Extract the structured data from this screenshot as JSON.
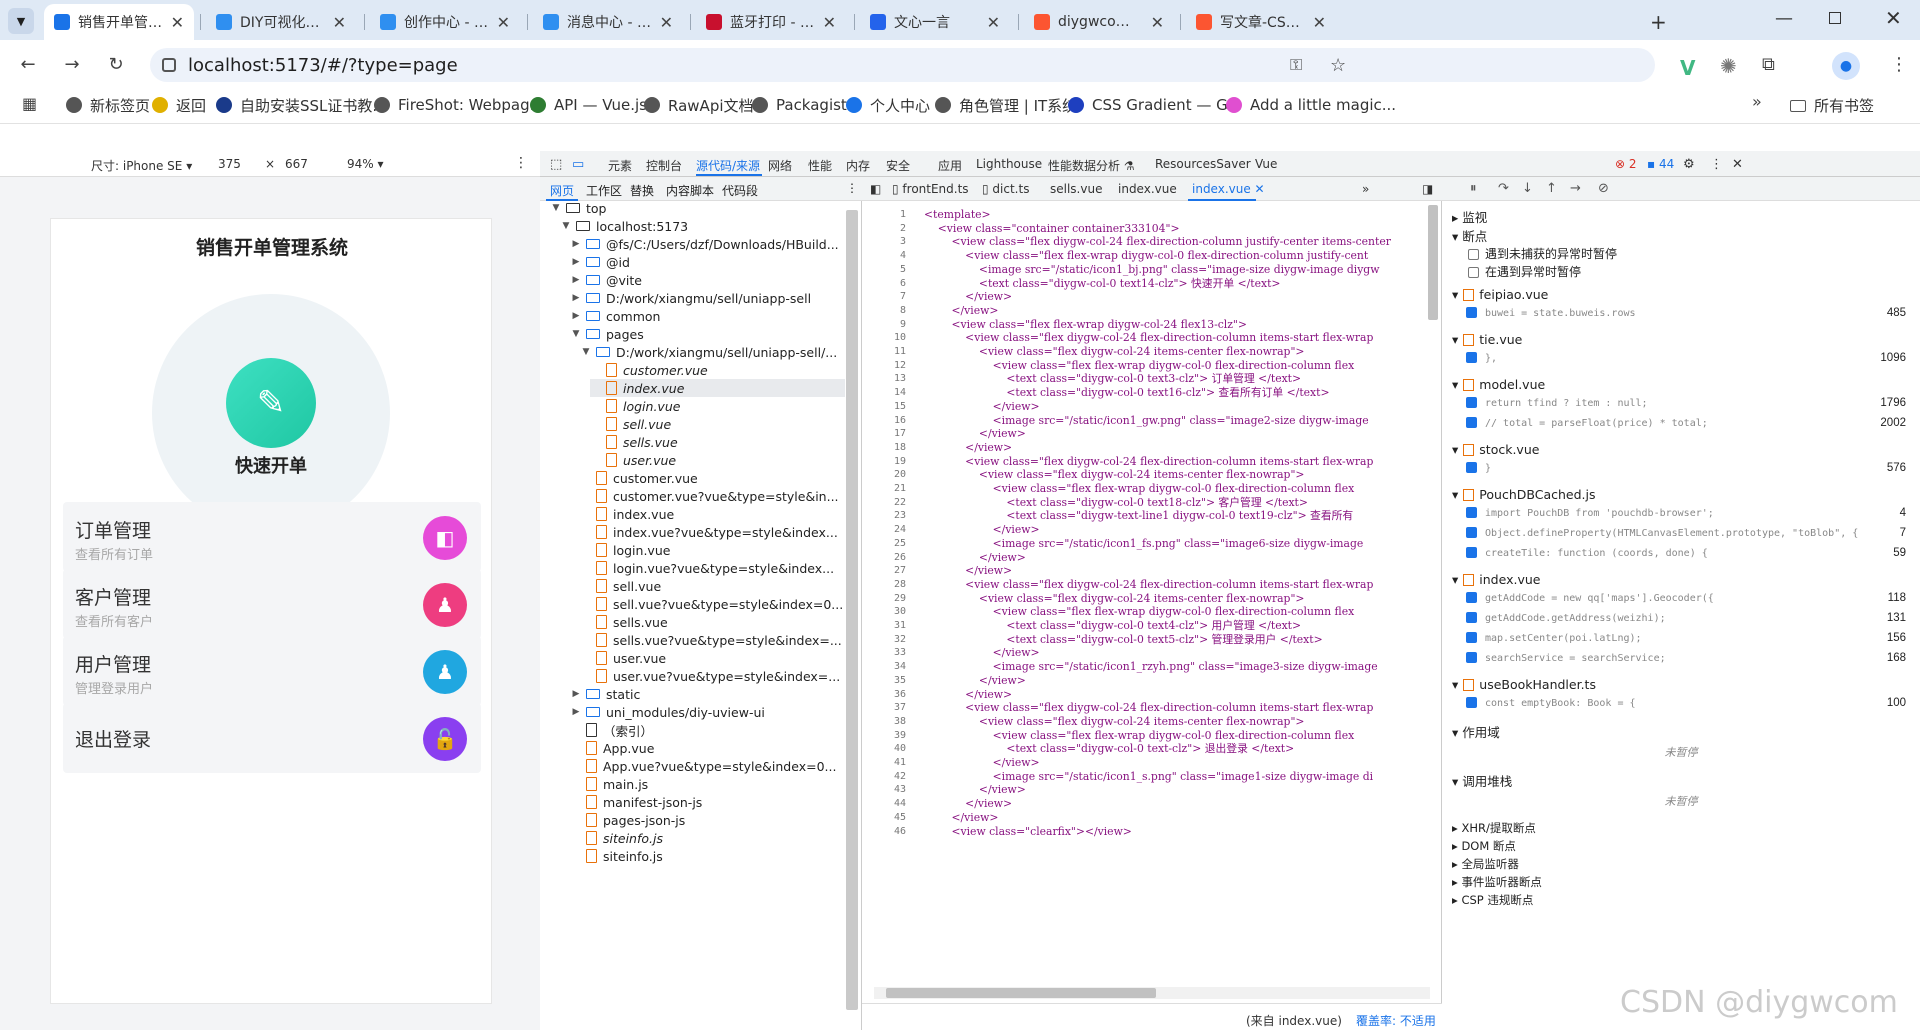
{
  "browser": {
    "tabs": [
      {
        "label": "销售开单管理系统",
        "color": "#1a73e8"
      },
      {
        "label": "DIY可视化的个人",
        "color": "#2f8ff0"
      },
      {
        "label": "创作中心 - 哔哩",
        "color": "#2f8ff0"
      },
      {
        "label": "消息中心 - 哔哩",
        "color": "#2f8ff0"
      },
      {
        "label": "蓝牙打印 - 商品",
        "color": "#c8102e"
      },
      {
        "label": "文心一言",
        "color": "#2463eb"
      },
      {
        "label": "diygwcom-CSD",
        "color": "#fc5531"
      },
      {
        "label": "写文章-CSDN创",
        "color": "#fc5531"
      }
    ],
    "url": "localhost:5173/#/?type=page",
    "bookmarks": [
      "新标签页",
      "返回",
      "自助安装SSL证书教...",
      "FireShot: Webpag...",
      "API — Vue.js",
      "RawApi文档",
      "Packagist",
      "个人中心",
      "角色管理 | IT系统",
      "CSS Gradient — G...",
      "Add a little magic..."
    ],
    "all_bookmarks": "所有书签"
  },
  "device_bar": {
    "size_label": "尺寸: iPhone SE",
    "width": "375",
    "times": "×",
    "height": "667",
    "zoom": "94%"
  },
  "app": {
    "title": "销售开单管理系统",
    "quick_label": "快速开单",
    "cards": [
      {
        "title": "订单管理",
        "subtitle": "查看所有订单",
        "color": "#e64bd8"
      },
      {
        "title": "客户管理",
        "subtitle": "查看所有客户",
        "color": "#ee3d80"
      },
      {
        "title": "用户管理",
        "subtitle": "管理登录用户",
        "color": "#20a7e0"
      },
      {
        "title": "退出登录",
        "subtitle": "",
        "color": "#8a3ff0"
      }
    ]
  },
  "devtools": {
    "top_tabs": [
      "元素",
      "控制台",
      "源代码/来源",
      "网络",
      "性能",
      "内存",
      "安全",
      "应用",
      "Lighthouse",
      "性能数据分析 ⚗",
      "ResourcesSaver",
      "Vue"
    ],
    "errors": "2",
    "messages": "44",
    "left_tabs": [
      "网页",
      "工作区",
      "替换",
      "内容脚本",
      "代码段"
    ],
    "editor_tabs": [
      "frontEnd.ts",
      "dict.ts",
      "sells.vue",
      "index.vue",
      "index.vue"
    ],
    "tree": [
      {
        "label": "top",
        "indent": 0,
        "kind": "frame",
        "arrow": "▼"
      },
      {
        "label": "localhost:5173",
        "indent": 1,
        "kind": "cloud",
        "arrow": "▼"
      },
      {
        "label": "@fs/C:/Users/dzf/Downloads/HBuild...",
        "indent": 2,
        "kind": "folder",
        "arrow": "▶"
      },
      {
        "label": "@id",
        "indent": 2,
        "kind": "folder",
        "arrow": "▶"
      },
      {
        "label": "@vite",
        "indent": 2,
        "kind": "folder",
        "arrow": "▶"
      },
      {
        "label": "D:/work/xiangmu/sell/uniapp-sell",
        "indent": 2,
        "kind": "folder",
        "arrow": "▶"
      },
      {
        "label": "common",
        "indent": 2,
        "kind": "folder",
        "arrow": "▶"
      },
      {
        "label": "pages",
        "indent": 2,
        "kind": "folder",
        "arrow": "▼"
      },
      {
        "label": "D:/work/xiangmu/sell/uniapp-sell/...",
        "indent": 3,
        "kind": "folder",
        "arrow": "▼"
      },
      {
        "label": "customer.vue",
        "indent": 4,
        "kind": "file",
        "arrow": "",
        "italic": true
      },
      {
        "label": "index.vue",
        "indent": 4,
        "kind": "file",
        "arrow": "",
        "italic": true,
        "selected": true
      },
      {
        "label": "login.vue",
        "indent": 4,
        "kind": "file",
        "arrow": "",
        "italic": true
      },
      {
        "label": "sell.vue",
        "indent": 4,
        "kind": "file",
        "arrow": "",
        "italic": true
      },
      {
        "label": "sells.vue",
        "indent": 4,
        "kind": "file",
        "arrow": "",
        "italic": true
      },
      {
        "label": "user.vue",
        "indent": 4,
        "kind": "file",
        "arrow": "",
        "italic": true
      },
      {
        "label": "customer.vue",
        "indent": 3,
        "kind": "file",
        "arrow": ""
      },
      {
        "label": "customer.vue?vue&type=style&in...",
        "indent": 3,
        "kind": "file",
        "arrow": ""
      },
      {
        "label": "index.vue",
        "indent": 3,
        "kind": "file",
        "arrow": ""
      },
      {
        "label": "index.vue?vue&type=style&index...",
        "indent": 3,
        "kind": "file",
        "arrow": ""
      },
      {
        "label": "login.vue",
        "indent": 3,
        "kind": "file",
        "arrow": ""
      },
      {
        "label": "login.vue?vue&type=style&index...",
        "indent": 3,
        "kind": "file",
        "arrow": ""
      },
      {
        "label": "sell.vue",
        "indent": 3,
        "kind": "file",
        "arrow": ""
      },
      {
        "label": "sell.vue?vue&type=style&index=0...",
        "indent": 3,
        "kind": "file",
        "arrow": ""
      },
      {
        "label": "sells.vue",
        "indent": 3,
        "kind": "file",
        "arrow": ""
      },
      {
        "label": "sells.vue?vue&type=style&index=...",
        "indent": 3,
        "kind": "file",
        "arrow": ""
      },
      {
        "label": "user.vue",
        "indent": 3,
        "kind": "file",
        "arrow": ""
      },
      {
        "label": "user.vue?vue&type=style&index=...",
        "indent": 3,
        "kind": "file",
        "arrow": ""
      },
      {
        "label": "static",
        "indent": 2,
        "kind": "folder",
        "arrow": "▶"
      },
      {
        "label": "uni_modules/diy-uview-ui",
        "indent": 2,
        "kind": "folder",
        "arrow": "▶"
      },
      {
        "label": "（索引）",
        "indent": 2,
        "kind": "page",
        "arrow": ""
      },
      {
        "label": "App.vue",
        "indent": 2,
        "kind": "file",
        "arrow": ""
      },
      {
        "label": "App.vue?vue&type=style&index=0...",
        "indent": 2,
        "kind": "file",
        "arrow": ""
      },
      {
        "label": "main.js",
        "indent": 2,
        "kind": "file",
        "arrow": ""
      },
      {
        "label": "manifest-json-js",
        "indent": 2,
        "kind": "file",
        "arrow": ""
      },
      {
        "label": "pages-json-js",
        "indent": 2,
        "kind": "file",
        "arrow": ""
      },
      {
        "label": "siteinfo.js",
        "indent": 2,
        "kind": "file",
        "arrow": "",
        "italic": true
      },
      {
        "label": "siteinfo.js",
        "indent": 2,
        "kind": "file",
        "arrow": ""
      }
    ],
    "code": [
      "<template>",
      "    <view class=\"container container333104\">",
      "        <view class=\"flex diygw-col-24 flex-direction-column justify-center items-center",
      "            <view class=\"flex flex-wrap diygw-col-0 flex-direction-column justify-cent",
      "                <image src=\"/static/icon1_bj.png\" class=\"image-size diygw-image diygw",
      "                <text class=\"diygw-col-0 text14-clz\"> 快速开单 </text>",
      "            </view>",
      "        </view>",
      "        <view class=\"flex flex-wrap diygw-col-24 flex13-clz\">",
      "            <view class=\"flex diygw-col-24 flex-direction-column items-start flex-wrap",
      "                <view class=\"flex diygw-col-24 items-center flex-nowrap\">",
      "                    <view class=\"flex flex-wrap diygw-col-0 flex-direction-column flex",
      "                        <text class=\"diygw-col-0 text3-clz\"> 订单管理 </text>",
      "                        <text class=\"diygw-col-0 text16-clz\"> 查看所有订单 </text>",
      "                    </view>",
      "                    <image src=\"/static/icon1_gw.png\" class=\"image2-size diygw-image",
      "                </view>",
      "            </view>",
      "            <view class=\"flex diygw-col-24 flex-direction-column items-start flex-wrap",
      "                <view class=\"flex diygw-col-24 items-center flex-nowrap\">",
      "                    <view class=\"flex flex-wrap diygw-col-0 flex-direction-column flex",
      "                        <text class=\"diygw-col-0 text18-clz\"> 客户管理 </text>",
      "                        <text class=\"diygw-text-line1 diygw-col-0 text19-clz\"> 查看所有",
      "                    </view>",
      "                    <image src=\"/static/icon1_fs.png\" class=\"image6-size diygw-image",
      "                </view>",
      "            </view>",
      "            <view class=\"flex diygw-col-24 flex-direction-column items-start flex-wrap",
      "                <view class=\"flex diygw-col-24 items-center flex-nowrap\">",
      "                    <view class=\"flex flex-wrap diygw-col-0 flex-direction-column flex",
      "                        <text class=\"diygw-col-0 text4-clz\"> 用户管理 </text>",
      "                        <text class=\"diygw-col-0 text5-clz\"> 管理登录用户 </text>",
      "                    </view>",
      "                    <image src=\"/static/icon1_rzyh.png\" class=\"image3-size diygw-image",
      "                </view>",
      "            </view>",
      "            <view class=\"flex diygw-col-24 flex-direction-column items-start flex-wrap",
      "                <view class=\"flex diygw-col-24 items-center flex-nowrap\">",
      "                    <view class=\"flex flex-wrap diygw-col-0 flex-direction-column flex",
      "                        <text class=\"diygw-col-0 text-clz\"> 退出登录 </text>",
      "                    </view>",
      "                    <image src=\"/static/icon1_s.png\" class=\"image1-size diygw-image di",
      "                </view>",
      "            </view>",
      "        </view>",
      "        <view class=\"clearfix\"></view>"
    ],
    "status_source": "(来自 index.vue)",
    "status_coverage": "覆盖率: 不适用",
    "right": {
      "watch": "监视",
      "breakpoints": "断点",
      "pause_uncaught": "遇到未捕获的异常时暂停",
      "pause_caught": "在遇到异常时暂停",
      "groups": [
        {
          "file": "feipiao.vue",
          "items": [
            {
              "code": "buwei = state.buweis.rows",
              "line": "485"
            }
          ]
        },
        {
          "file": "tie.vue",
          "items": [
            {
              "code": "},",
              "line": "1096"
            }
          ]
        },
        {
          "file": "model.vue",
          "items": [
            {
              "code": "return tfind ? item : null;",
              "line": "1796"
            },
            {
              "code": "// total = parseFloat(price) * total;",
              "line": "2002"
            }
          ]
        },
        {
          "file": "stock.vue",
          "items": [
            {
              "code": "}",
              "line": "576"
            }
          ]
        },
        {
          "file": "PouchDBCached.js",
          "items": [
            {
              "code": "import PouchDB from 'pouchdb-browser';",
              "line": "4"
            },
            {
              "code": "Object.defineProperty(HTMLCanvasElement.prototype, \"toBlob\", {",
              "line": "7"
            },
            {
              "code": "createTile: function (coords, done) {",
              "line": "59"
            }
          ]
        },
        {
          "file": "index.vue",
          "items": [
            {
              "code": "getAddCode = new qq['maps'].Geocoder({",
              "line": "118"
            },
            {
              "code": "getAddCode.getAddress(weizhi);",
              "line": "131"
            },
            {
              "code": "map.setCenter(poi.latLng);",
              "line": "156"
            },
            {
              "code": "searchService = searchService;",
              "line": "168"
            }
          ]
        },
        {
          "file": "useBookHandler.ts",
          "items": [
            {
              "code": "const emptyBook: Book = {",
              "line": "100"
            }
          ]
        }
      ],
      "scope": "作用域",
      "not_paused": "未暂停",
      "call_stack": "调用堆栈",
      "not_paused2": "未暂停",
      "bottom_sections": [
        "XHR/提取断点",
        "DOM 断点",
        "全局监听器",
        "事件监听器断点",
        "CSP 违规断点"
      ]
    }
  },
  "watermark": "CSDN @diygwcom"
}
